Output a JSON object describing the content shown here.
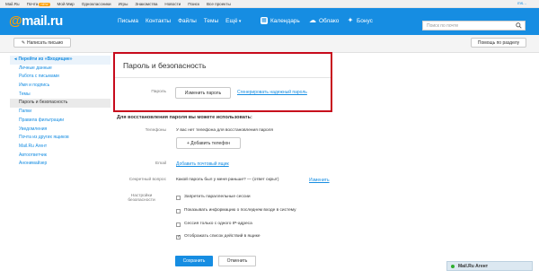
{
  "topbar": {
    "items": [
      "Mail.Ru",
      "Почта",
      "Мой Мир",
      "Одноклассники",
      "Игры",
      "Знакомства",
      "Новости",
      "Поиск",
      "Все проекты"
    ],
    "badge": "NEW",
    "right": "ms..."
  },
  "header": {
    "logo_at": "@",
    "logo_text": "mail.ru",
    "nav": [
      "Письма",
      "Контакты",
      "Файлы",
      "Темы",
      "Ещё"
    ],
    "calendar": "Календарь",
    "cloud": "Облако",
    "bonus": "Бонус",
    "search_placeholder": "Поиск по почте"
  },
  "toolbar": {
    "compose": "Написать письмо",
    "help": "Помощь по разделу"
  },
  "sidebar": {
    "items": [
      "Перейти из «Входящие»",
      "Личные данные",
      "Работа с письмами",
      "Имя и подпись",
      "Темы",
      "Пароль и безопасность",
      "Папки",
      "Правила фильтрации",
      "Уведомления",
      "Почта из других ящиков",
      "Mail.Ru Агент",
      "Автоответчик",
      "Анонимайзер"
    ],
    "active_index": 5
  },
  "main": {
    "title": "Пароль и безопасность",
    "password_label": "Пароль",
    "change_password": "Изменить пароль",
    "generate_password": "Сгенерировать надежный пароль",
    "recovery_heading": "Для восстановления пароля вы можете использовать:",
    "phones_label": "Телефоны",
    "phones_text": "У вас нет телефона для восстановления пароля",
    "add_phone": "+ Добавить телефон",
    "email_label": "Email",
    "add_email": "Добавить почтовый ящик",
    "secret_label": "Секретный вопрос",
    "secret_text": "Какой пароль был у меня раньше? — (ответ скрыт)",
    "secret_change": "Изменить",
    "security_label_1": "Настройки",
    "security_label_2": "безопасности",
    "options": [
      {
        "label": "Запретить параллельные сессии",
        "checked": false
      },
      {
        "label": "Показывать информацию о последнем входе в систему",
        "checked": false
      },
      {
        "label": "Сессия только с одного IP-адреса",
        "checked": false
      },
      {
        "label": "Отображать список действий в ящике",
        "checked": true
      }
    ],
    "save": "Сохранить",
    "cancel": "Отменить"
  },
  "agent": "Mail.Ru Агент",
  "colors": {
    "accent": "#168de2",
    "highlight_frame": "#c70a1c",
    "logo_at": "#ff9e00"
  }
}
